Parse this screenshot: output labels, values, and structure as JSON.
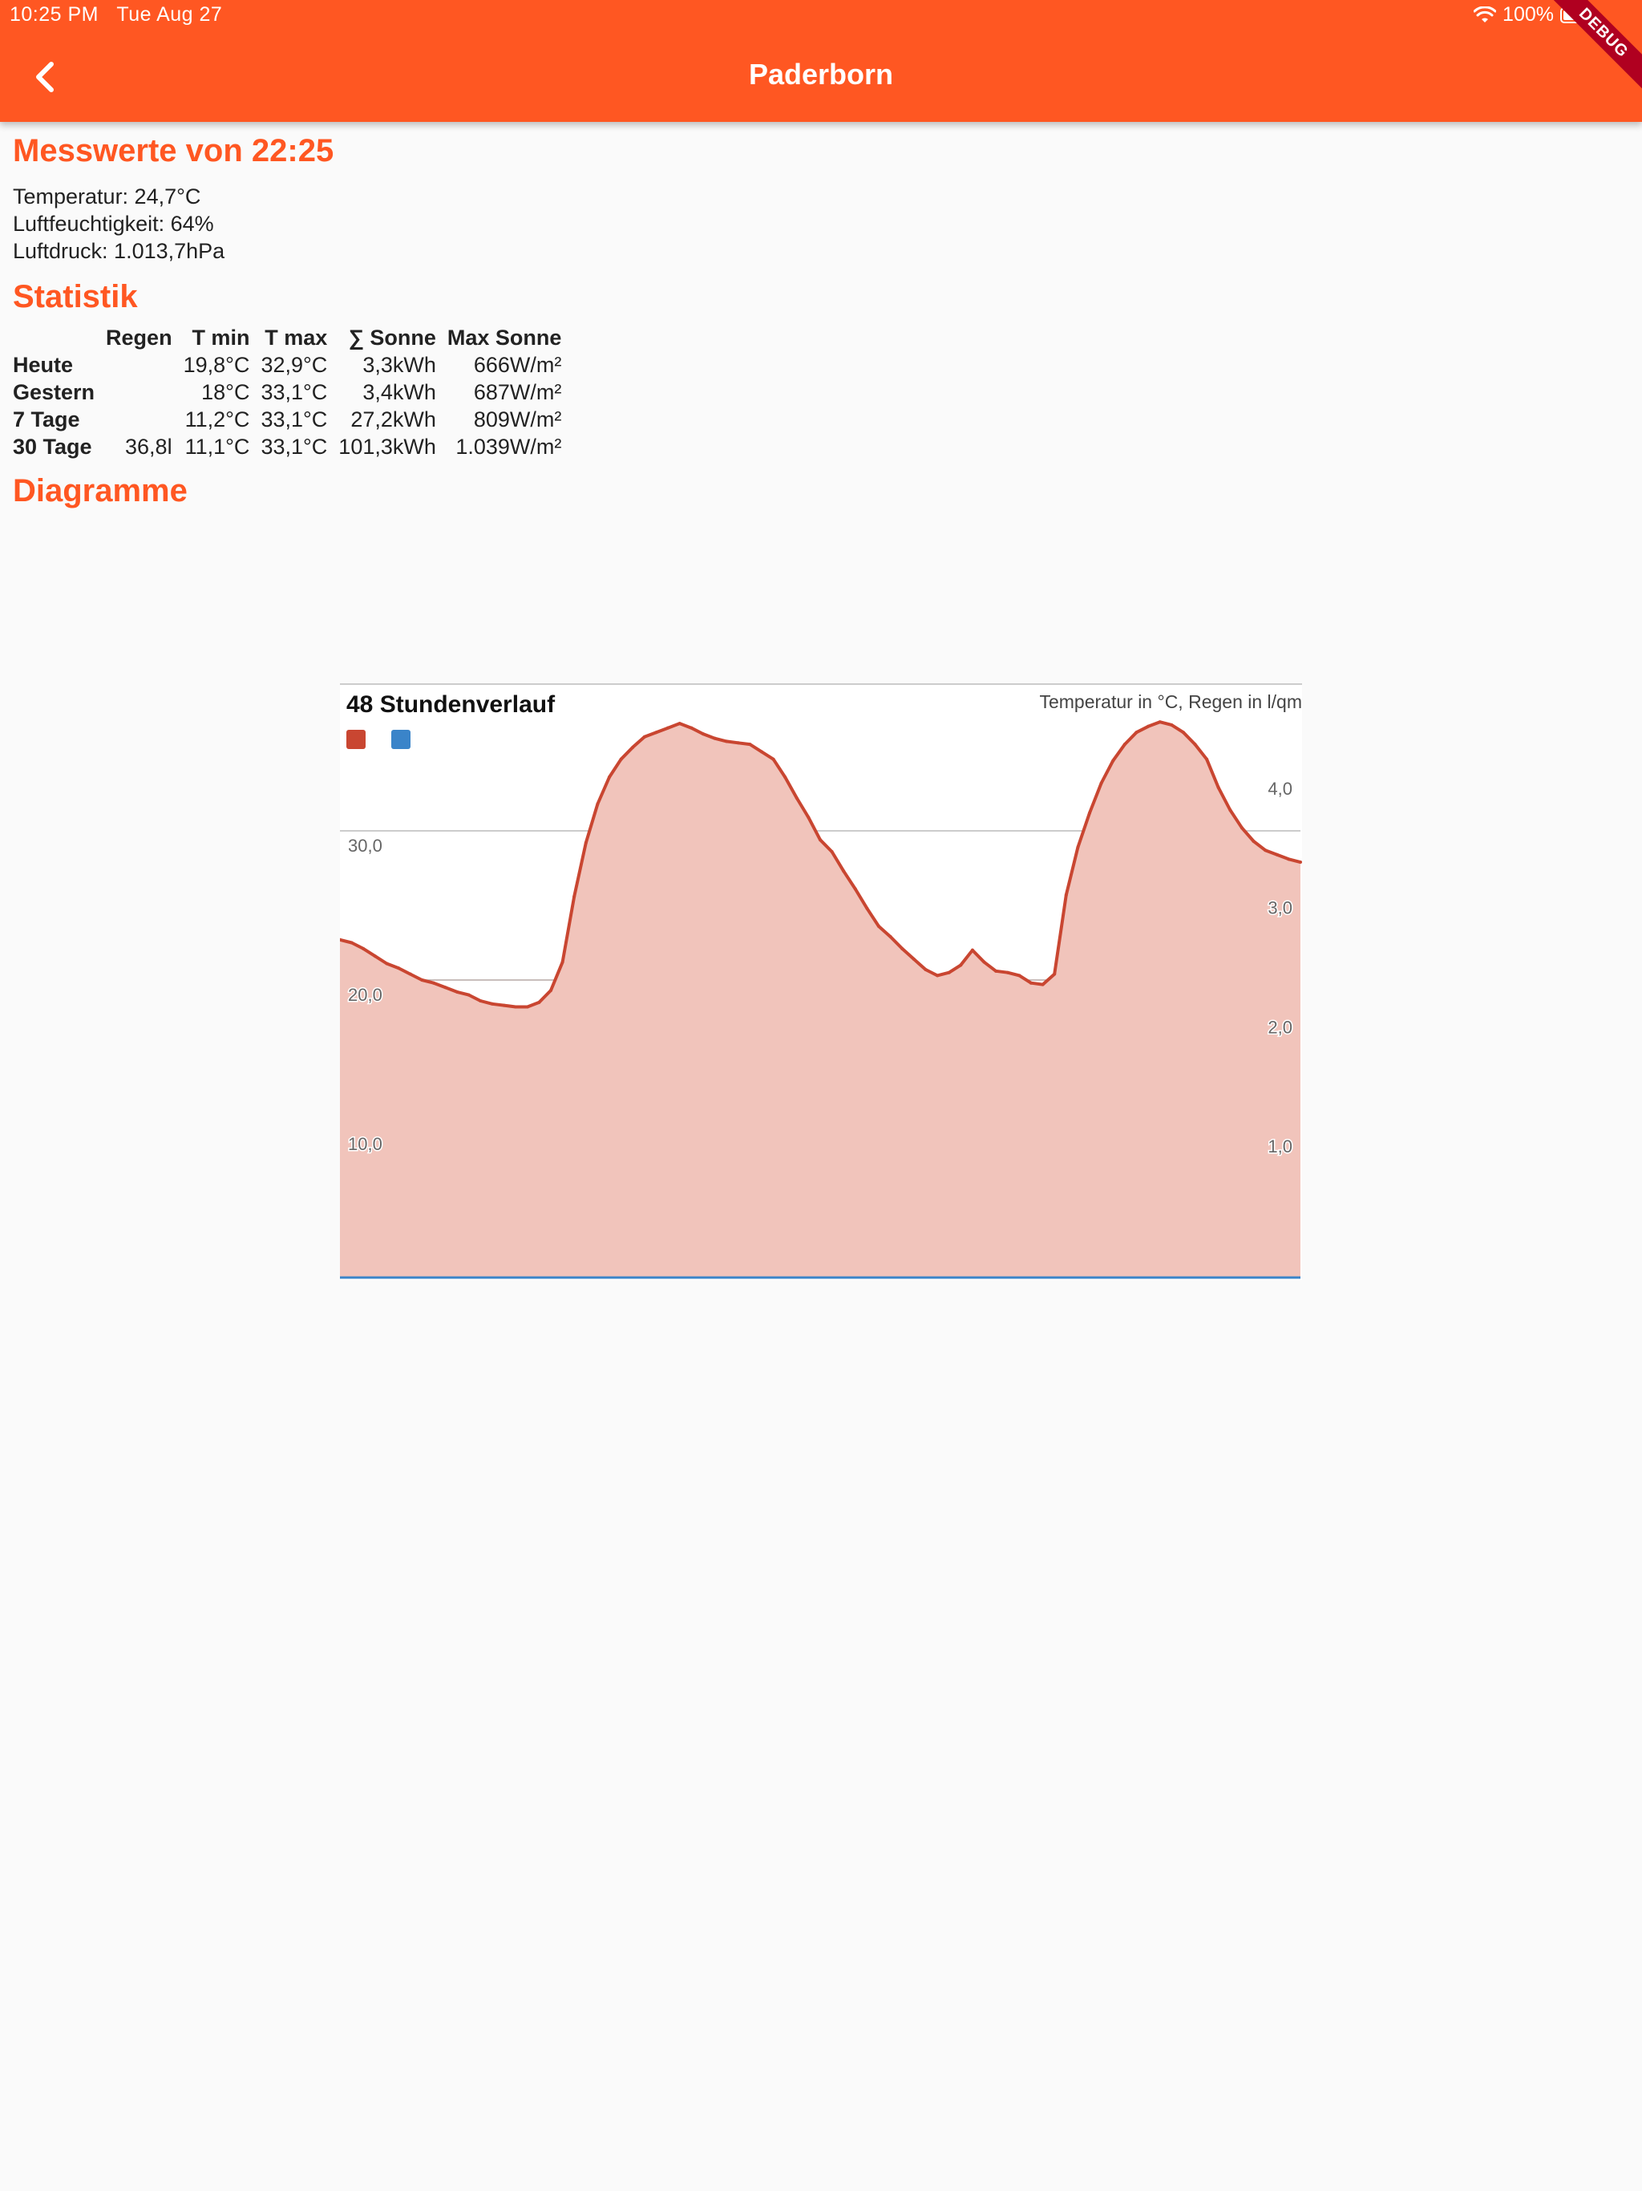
{
  "status_bar": {
    "time": "10:25 PM",
    "date": "Tue Aug 27",
    "battery": "100%"
  },
  "app_bar": {
    "title": "Paderborn",
    "debug_banner": "DEBUG"
  },
  "measurement": {
    "heading": "Messwerte von 22:25",
    "lines": [
      "Temperatur: 24,7°C",
      "Luftfeuchtigkeit: 64%",
      "Luftdruck: 1.013,7hPa"
    ]
  },
  "statistics": {
    "heading": "Statistik",
    "columns": [
      "",
      "Regen",
      "T min",
      "T max",
      "∑ Sonne",
      "Max Sonne"
    ],
    "rows": [
      [
        "Heute",
        "",
        "19,8°C",
        "32,9°C",
        "3,3kWh",
        "666W/m²"
      ],
      [
        "Gestern",
        "",
        "18°C",
        "33,1°C",
        "3,4kWh",
        "687W/m²"
      ],
      [
        "7 Tage",
        "",
        "11,2°C",
        "33,1°C",
        "27,2kWh",
        "809W/m²"
      ],
      [
        "30 Tage",
        "36,8l",
        "11,1°C",
        "33,1°C",
        "101,3kWh",
        "1.039W/m²"
      ]
    ]
  },
  "diagrams": {
    "heading": "Diagramme"
  },
  "colors": {
    "accent": "#ff5722",
    "temperature": "#c94631",
    "temperature_fill": "#f1c4bb",
    "rain": "#3a84c9"
  },
  "chart_data": {
    "type": "area",
    "title": "48 Stundenverlauf",
    "subtitle": "Temperatur in °C, Regen in l/qm",
    "y_left_ticks": [
      "30,0",
      "20,0",
      "10,0"
    ],
    "y_right_ticks": [
      "4,0",
      "3,0",
      "2,0",
      "1,0"
    ],
    "ylim_left": [
      0,
      40
    ],
    "ylim_right": [
      0,
      5
    ],
    "grid": true,
    "series": [
      {
        "values": [
          22.7,
          22.5,
          22.1,
          21.6,
          21.1,
          20.8,
          20.4,
          20.0,
          19.8,
          19.5,
          19.2,
          19.0,
          18.6,
          18.4,
          18.3,
          18.2,
          18.2,
          18.5,
          19.3,
          21.2,
          25.6,
          29.2,
          31.8,
          33.6,
          34.8,
          35.6,
          36.3,
          36.6,
          36.9,
          37.2,
          36.9,
          36.5,
          36.2,
          36.0,
          35.9,
          35.8,
          35.3,
          34.8,
          33.6,
          32.2,
          30.9,
          29.4,
          28.6,
          27.3,
          26.1,
          24.8,
          23.6,
          22.9,
          22.1,
          21.4,
          20.7,
          20.3,
          20.5,
          21.0,
          22.0,
          21.2,
          20.6,
          20.5,
          20.3,
          19.8,
          19.7,
          20.4,
          25.7,
          28.9,
          31.2,
          33.2,
          34.7,
          35.8,
          36.6,
          37.0,
          37.3,
          37.1,
          36.6,
          35.8,
          34.8,
          32.9,
          31.4,
          30.2,
          29.3,
          28.7,
          28.4,
          28.1,
          27.9
        ]
      },
      {
        "values": [
          0,
          0,
          0,
          0,
          0,
          0,
          0,
          0,
          0,
          0,
          0,
          0,
          0,
          0,
          0,
          0,
          0,
          0,
          0,
          0,
          0,
          0,
          0,
          0,
          0,
          0,
          0,
          0,
          0,
          0,
          0,
          0,
          0,
          0,
          0,
          0,
          0,
          0,
          0,
          0,
          0,
          0,
          0,
          0,
          0,
          0,
          0,
          0,
          0,
          0,
          0,
          0,
          0,
          0,
          0,
          0,
          0,
          0,
          0,
          0,
          0,
          0,
          0,
          0,
          0,
          0,
          0,
          0,
          0,
          0,
          0,
          0,
          0,
          0,
          0,
          0,
          0,
          0,
          0,
          0,
          0,
          0,
          0
        ]
      }
    ]
  }
}
